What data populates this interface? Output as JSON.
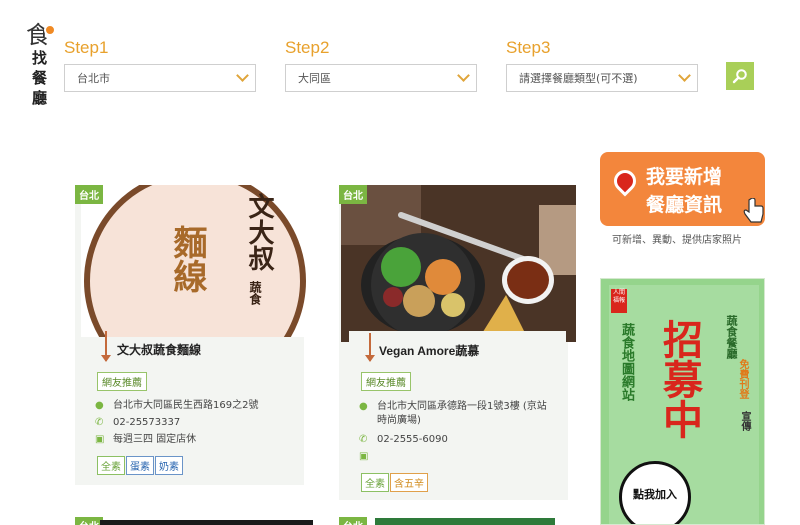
{
  "logo": {
    "glyph": "食",
    "text": "找餐廳"
  },
  "steps": [
    {
      "label": "Step1",
      "value": "台北市"
    },
    {
      "label": "Step2",
      "value": "大同區"
    },
    {
      "label": "Step3",
      "value": "請選擇餐廳類型(可不選)"
    }
  ],
  "cards": [
    {
      "tag": "台北",
      "image_title": "文大叔",
      "image_sub": "蔬食",
      "image_main": "麵線",
      "title": "文大叔蔬食麵線",
      "badge": "網友推薦",
      "address": "台北市大同區民生西路169之2號",
      "phone": "02-25573337",
      "hours": "每週三四 固定店休",
      "diets": [
        "全素",
        "蛋素",
        "奶素"
      ]
    },
    {
      "tag": "台北",
      "title": "Vegan Amore蔬慕",
      "badge": "網友推薦",
      "address": "台北市大同區承德路一段1號3樓 (京站時尚廣場)",
      "phone": "02-2555-6090",
      "hours": "",
      "diets": [
        "全素",
        "含五辛"
      ]
    }
  ],
  "bottom_tags": [
    "台北",
    "台北"
  ],
  "ads": {
    "add": {
      "line1": "我要新增",
      "line2": "餐廳資訊",
      "caption": "可新增、異動、提供店家照片"
    },
    "recruit": {
      "brand": "人間福報",
      "left": "蔬食地圖網站",
      "right_top": "蔬食餐廳",
      "right_mid": "免費刊登",
      "right_bot": "宣傳",
      "main": "招募中",
      "join": "點我加入"
    }
  },
  "colors": {
    "accent": "#e8a12c",
    "green": "#7bb642",
    "orange": "#f3863c"
  }
}
